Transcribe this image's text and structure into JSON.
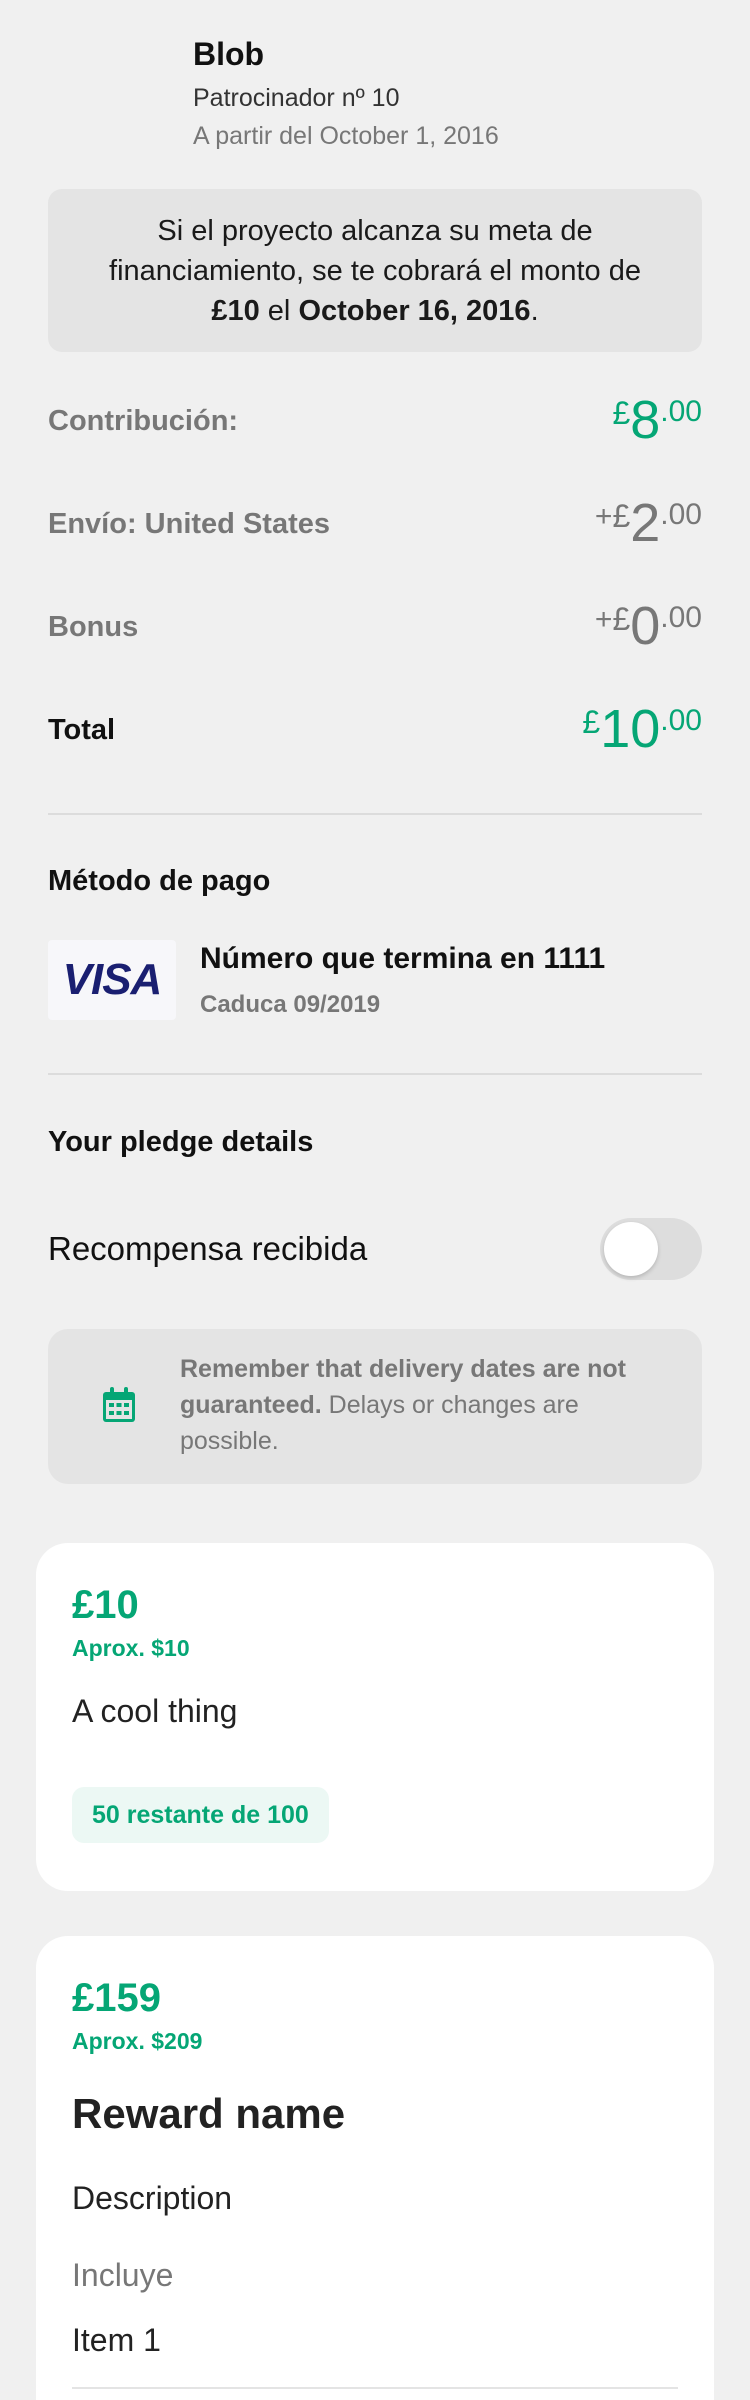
{
  "backer": {
    "name": "Blob",
    "sequence": "Patrocinador nº 10",
    "since": "A partir del October 1, 2016"
  },
  "notice": {
    "text_before": "Si el proyecto alcanza su meta de financiamiento, se te cobrará el monto de ",
    "amount": "£10",
    "text_middle": " el ",
    "date": "October 16, 2016",
    "text_after": "."
  },
  "summary": {
    "contribution": {
      "label": "Contribución:",
      "prefix": "",
      "currency": "£",
      "whole": "8",
      "cents": ".00"
    },
    "shipping": {
      "label": "Envío: United States",
      "prefix": "+",
      "currency": "£",
      "whole": "2",
      "cents": ".00"
    },
    "bonus": {
      "label": "Bonus",
      "prefix": "+",
      "currency": "£",
      "whole": "0",
      "cents": ".00"
    },
    "total": {
      "label": "Total",
      "prefix": "",
      "currency": "£",
      "whole": "10",
      "cents": ".00"
    }
  },
  "payment": {
    "title": "Método de pago",
    "brand": "VISA",
    "card_number": "Número que termina en 1111",
    "expiry": "Caduca 09/2019"
  },
  "pledge_details": {
    "title": "Your pledge details",
    "toggle_label": "Recompensa recibida",
    "toggle_on": false
  },
  "delivery_note": {
    "bold": "Remember that delivery dates are not guaranteed.",
    "rest": " Delays or changes are possible.",
    "icon": "calendar-icon"
  },
  "rewards": [
    {
      "price": "£10",
      "approx": "Aprox. $10",
      "title": "A cool thing",
      "remaining": "50 restante de 100"
    },
    {
      "price": "£159",
      "approx": "Aprox. $209",
      "name": "Reward name",
      "description": "Description",
      "includes_label": "Incluye",
      "items": [
        "Item 1"
      ]
    }
  ],
  "colors": {
    "accent": "#05A675",
    "background": "#f0f0f0",
    "muted": "#777777",
    "visa": "#1a1f71"
  }
}
